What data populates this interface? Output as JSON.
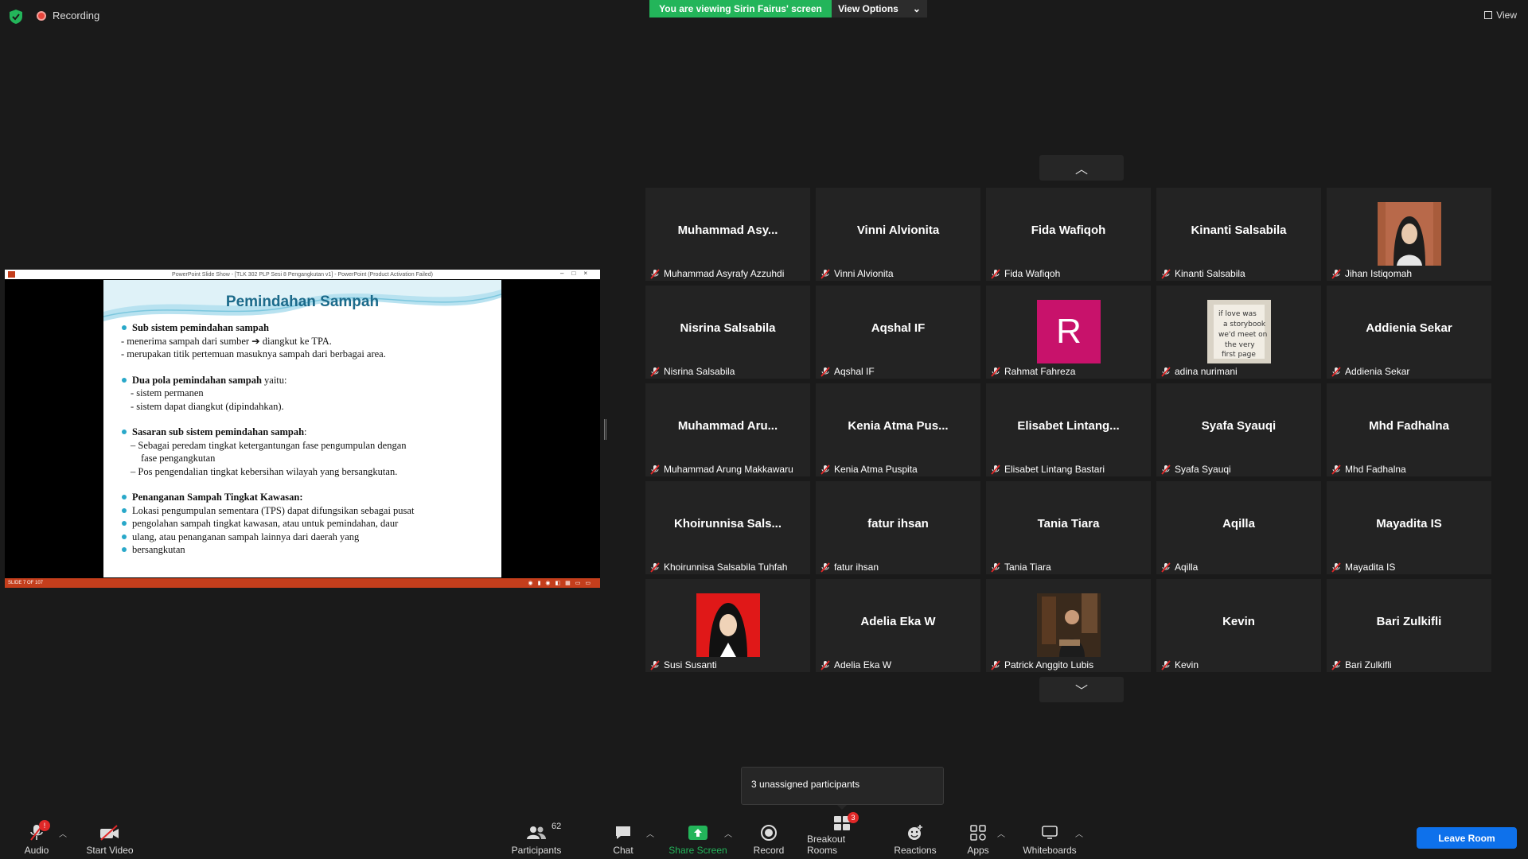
{
  "top": {
    "recording_label": "Recording",
    "viewing_label": "You are viewing Sirin Fairus' screen",
    "view_options_label": "View Options",
    "view_label": "View"
  },
  "share": {
    "ppt_title": "PowerPoint Slide Show - [TLK 302 PLP Sesi 8 Pengangkutan v1] - PowerPoint (Product Activation Failed)",
    "slide_title": "Pemindahan Sampah",
    "b1_head": "Sub sistem pemindahan sampah",
    "b1_l1": "- menerima sampah dari sumber ➔ diangkut ke TPA.",
    "b1_l2": "- merupakan titik pertemuan masuknya sampah dari berbagai area.",
    "b2_head": "Dua pola pemindahan sampah",
    "b2_tail": " yaitu:",
    "b2_l1": "- sistem permanen",
    "b2_l2": "- sistem dapat diangkut (dipindahkan).",
    "b3_head": "Sasaran sub sistem pemindahan sampah",
    "b3_tail": ":",
    "b3_l1": "– Sebagai peredam tingkat ketergantungan fase pengumpulan dengan",
    "b3_l1b": "fase pengangkutan",
    "b3_l2": "– Pos pengendalian tingkat kebersihan wilayah yang bersangkutan.",
    "b4_head": "Penanganan Sampah Tingkat Kawasan:",
    "b5_l1": "Lokasi pengumpulan sementara (TPS) dapat difungsikan sebagai pusat",
    "b5_l2": "pengolahan sampah tingkat kawasan, atau untuk pemindahan, daur",
    "b5_l3": "ulang, atau penanganan sampah lainnya dari daerah yang",
    "b5_l4": "bersangkutan",
    "status": "SLIDE 7 OF 107"
  },
  "participants": [
    {
      "big": "Muhammad  Asy...",
      "name": "Muhammad Asyrafy Azzuhdi"
    },
    {
      "big": "Vinni Alvionita",
      "name": "Vinni Alvionita"
    },
    {
      "big": "Fida Wafiqoh",
      "name": "Fida Wafiqoh"
    },
    {
      "big": "Kinanti Salsabila",
      "name": "Kinanti Salsabila"
    },
    {
      "big": "",
      "name": "Jihan Istiqomah",
      "photo": "hijab-person-photo"
    },
    {
      "big": "Nisrina Salsabila",
      "name": "Nisrina Salsabila"
    },
    {
      "big": "Aqshal IF",
      "name": "Aqshal IF"
    },
    {
      "big": "",
      "name": "Rahmat Fahreza",
      "letter": "R"
    },
    {
      "big": "",
      "name": "adina nurimani",
      "photo": "storybook-photo"
    },
    {
      "big": "Addienia Sekar",
      "name": "Addienia Sekar"
    },
    {
      "big": "Muhammad  Aru...",
      "name": "Muhammad Arung Makkawaru"
    },
    {
      "big": "Kenia Atma Pus...",
      "name": "Kenia Atma Puspita"
    },
    {
      "big": "Elisabet  Lintang...",
      "name": "Elisabet Lintang Bastari"
    },
    {
      "big": "Syafa Syauqi",
      "name": "Syafa Syauqi"
    },
    {
      "big": "Mhd Fadhalna",
      "name": "Mhd Fadhalna"
    },
    {
      "big": "Khoirunnisa  Sals...",
      "name": "Khoirunnisa Salsabila Tuhfah"
    },
    {
      "big": "fatur ihsan",
      "name": "fatur ihsan"
    },
    {
      "big": "Tania Tiara",
      "name": "Tania Tiara"
    },
    {
      "big": "Aqilla",
      "name": "Aqilla"
    },
    {
      "big": "Mayadita IS",
      "name": "Mayadita IS"
    },
    {
      "big": "",
      "name": "Susi Susanti",
      "photo": "red-background-portrait"
    },
    {
      "big": "Adelia Eka W",
      "name": "Adelia Eka W"
    },
    {
      "big": "",
      "name": "Patrick Anggito Lubis",
      "photo": "dim-room-photo"
    },
    {
      "big": "Kevin",
      "name": "Kevin"
    },
    {
      "big": "Bari Zulkifli",
      "name": "Bari Zulkifli"
    }
  ],
  "tooltip": "3 unassigned participants",
  "toolbar": {
    "audio": "Audio",
    "audio_badge": "!",
    "video": "Start Video",
    "participants": "Participants",
    "participants_count": "62",
    "chat": "Chat",
    "share": "Share Screen",
    "record": "Record",
    "breakout": "Breakout Rooms",
    "breakout_badge": "3",
    "reactions": "Reactions",
    "apps": "Apps",
    "whiteboards": "Whiteboards",
    "leave": "Leave Room"
  },
  "colors": {
    "share_green": "#23b55a",
    "leave_blue": "#0e71eb",
    "avatar_r": "#c8126b",
    "ppt_red": "#c43e1c",
    "mute_red": "#e02828"
  }
}
